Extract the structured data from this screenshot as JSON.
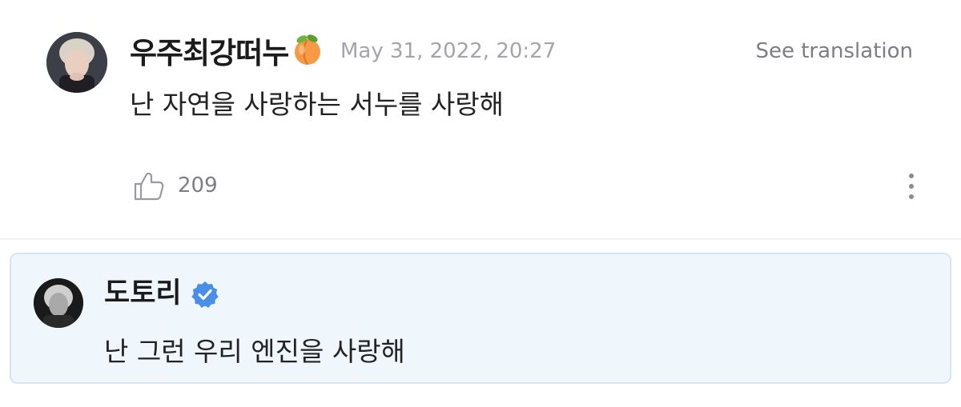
{
  "comment": {
    "username": "우주최강떠누",
    "username_emoji": "peach-emoji",
    "timestamp": "May 31, 2022, 20:27",
    "translate_label": "See translation",
    "text": "난 자연을 사랑하는 서누를 사랑해",
    "like_count": "209",
    "icons": {
      "like": "thumbs-up-icon",
      "more": "more-vertical-icon"
    }
  },
  "reply": {
    "username": "도토리",
    "verified_icon": "verified-badge-icon",
    "text": "난 그런 우리 엔진을 사랑해"
  },
  "colors": {
    "reply_background": "#eff7fc",
    "reply_border": "#d4e6f1",
    "verified_blue": "#4a8fe7",
    "muted_text": "#a4a4aa"
  }
}
